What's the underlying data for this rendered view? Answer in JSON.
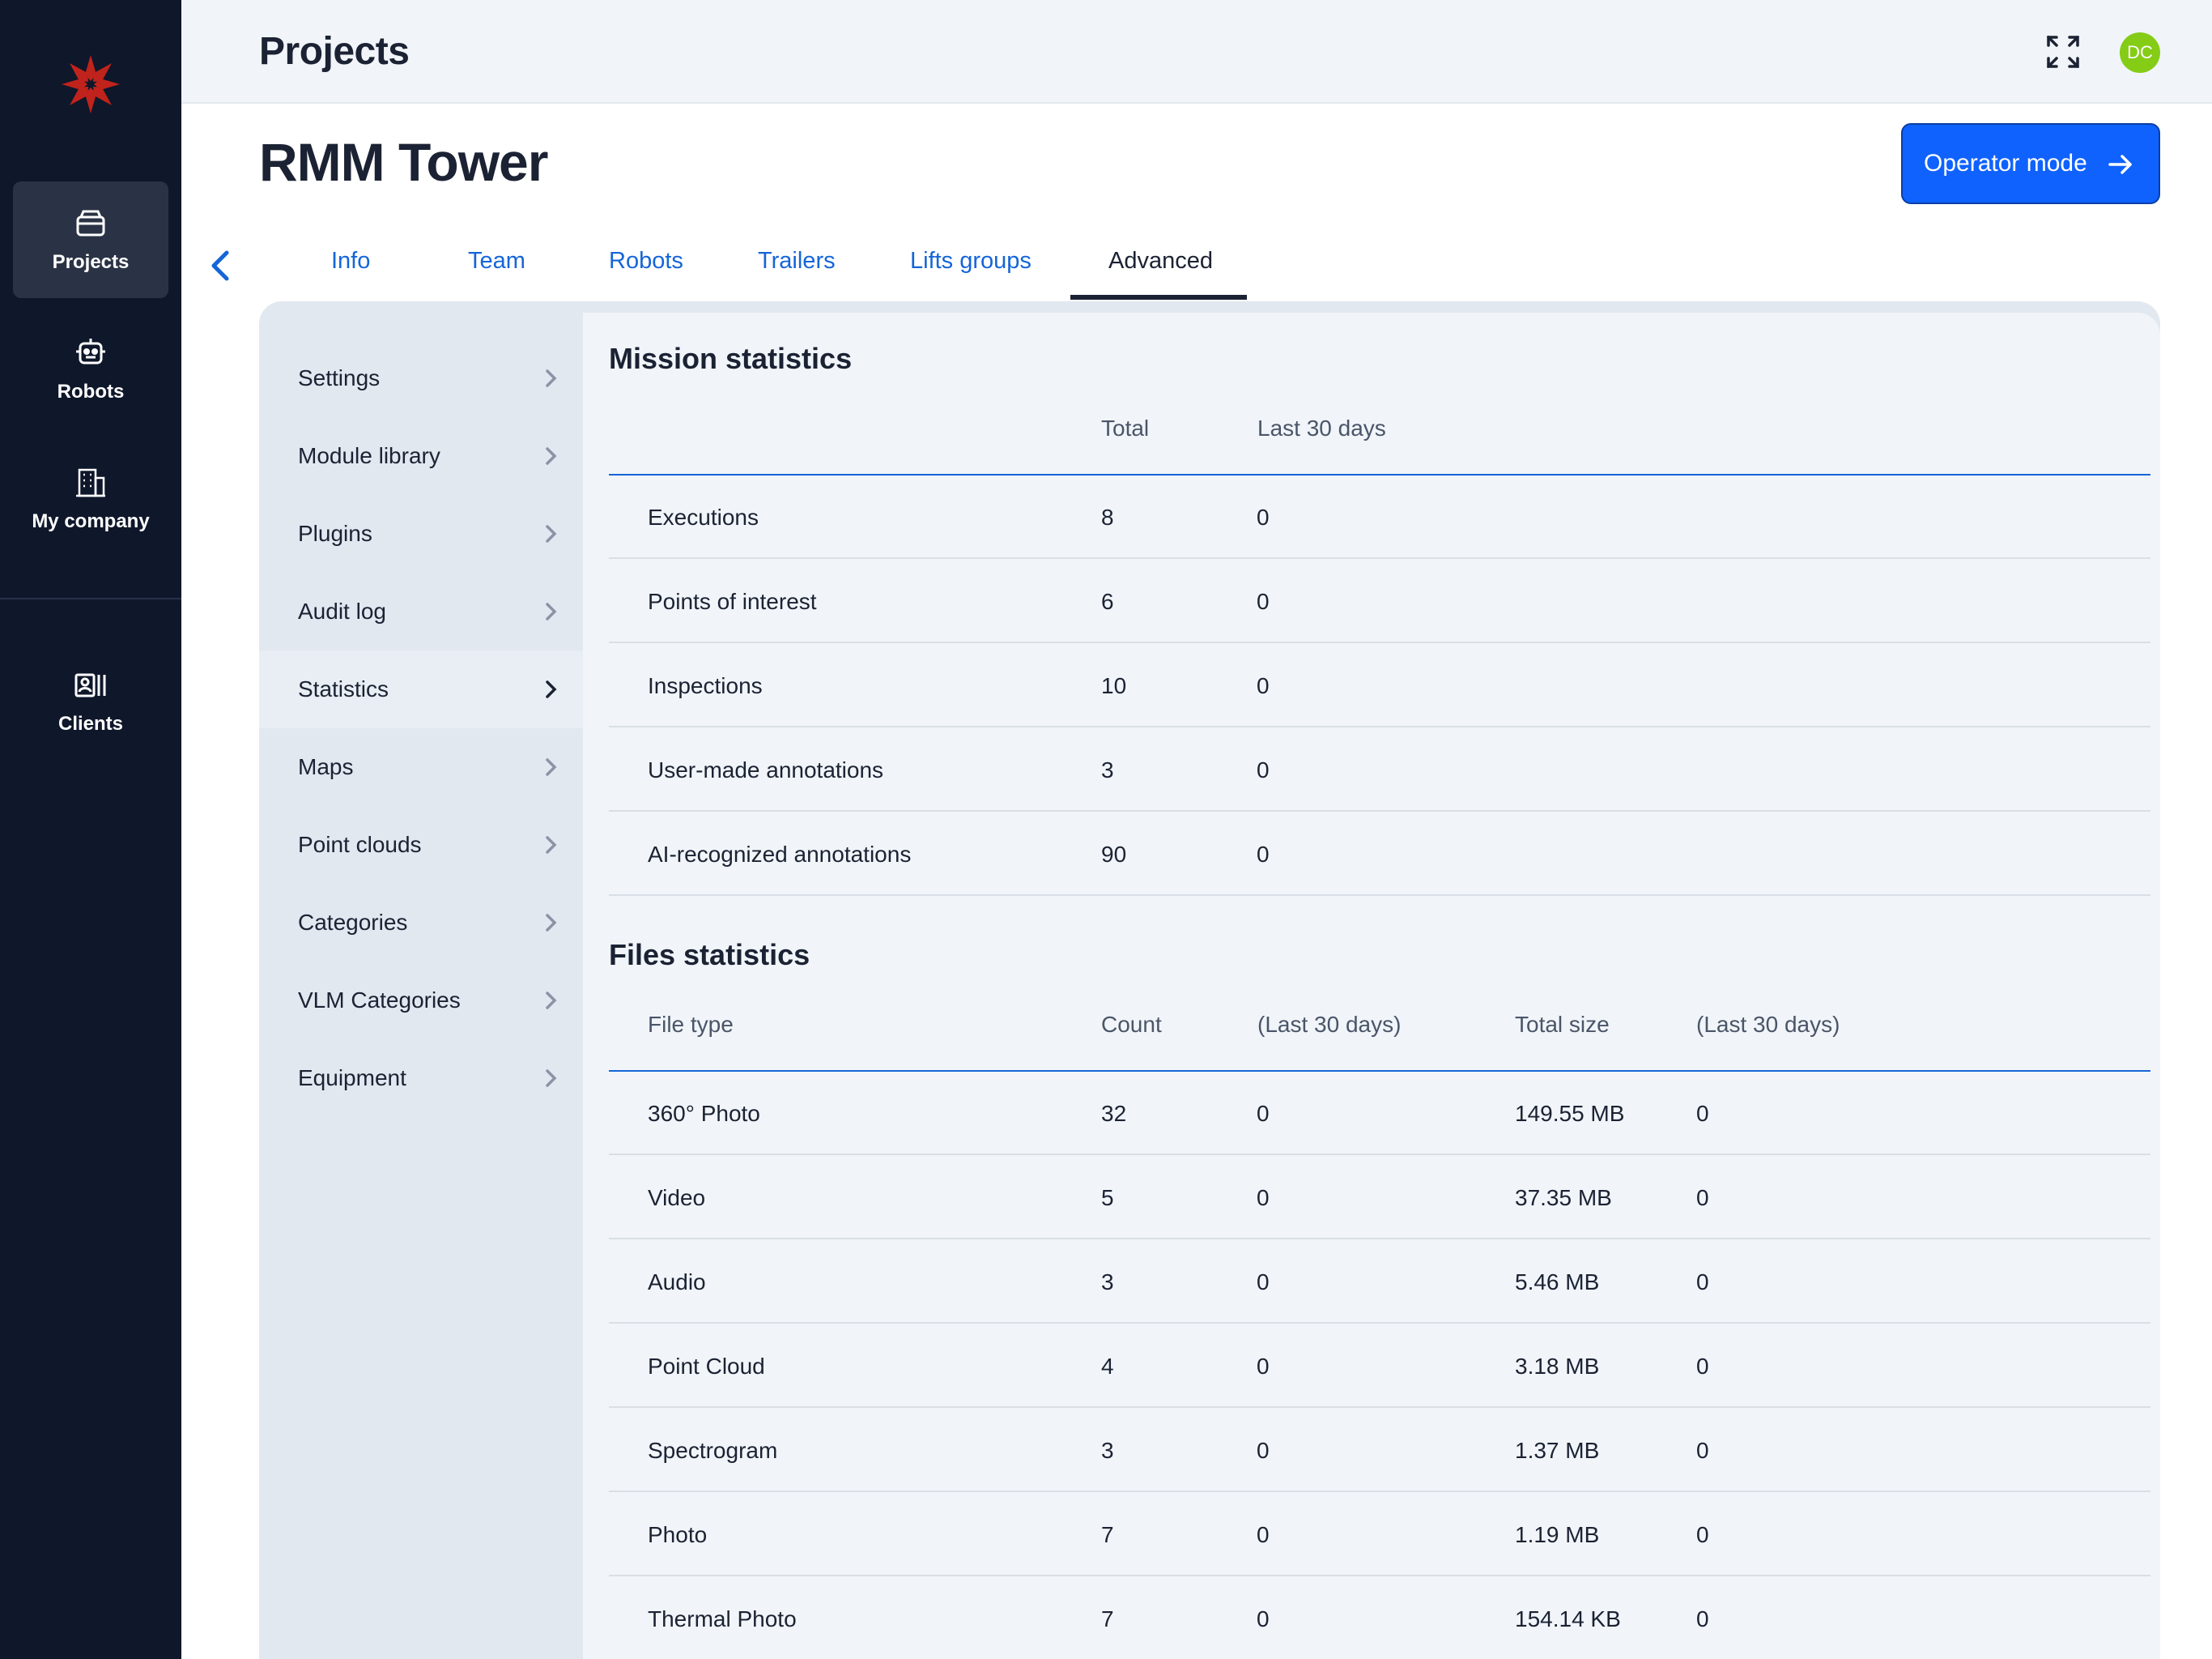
{
  "nav": {
    "items": [
      {
        "label": "Projects",
        "icon": "projects-icon",
        "active": true
      },
      {
        "label": "Robots",
        "icon": "robot-icon",
        "active": false
      },
      {
        "label": "My company",
        "icon": "building-icon",
        "active": false
      },
      {
        "label": "Clients",
        "icon": "clients-icon",
        "active": false
      }
    ]
  },
  "header": {
    "title": "Projects",
    "user_initials": "DC",
    "avatar_color": "#84cc16"
  },
  "project": {
    "name": "RMM Tower",
    "operator_button": "Operator mode"
  },
  "tabs": [
    {
      "label": "Info",
      "active": false
    },
    {
      "label": "Team",
      "active": false
    },
    {
      "label": "Robots",
      "active": false
    },
    {
      "label": "Trailers",
      "active": false
    },
    {
      "label": "Lifts groups",
      "active": false
    },
    {
      "label": "Advanced",
      "active": true
    }
  ],
  "side_menu": [
    {
      "label": "Settings",
      "active": false
    },
    {
      "label": "Module library",
      "active": false
    },
    {
      "label": "Plugins",
      "active": false
    },
    {
      "label": "Audit log",
      "active": false
    },
    {
      "label": "Statistics",
      "active": true
    },
    {
      "label": "Maps",
      "active": false
    },
    {
      "label": "Point clouds",
      "active": false
    },
    {
      "label": "Categories",
      "active": false
    },
    {
      "label": "VLM Categories",
      "active": false
    },
    {
      "label": "Equipment",
      "active": false
    }
  ],
  "mission_stats": {
    "title": "Mission statistics",
    "columns": [
      "",
      "Total",
      "Last 30 days"
    ],
    "rows": [
      {
        "name": "Executions",
        "total": "8",
        "last30": "0"
      },
      {
        "name": "Points of interest",
        "total": "6",
        "last30": "0"
      },
      {
        "name": "Inspections",
        "total": "10",
        "last30": "0"
      },
      {
        "name": "User-made annotations",
        "total": "3",
        "last30": "0"
      },
      {
        "name": "AI-recognized annotations",
        "total": "90",
        "last30": "0"
      }
    ]
  },
  "files_stats": {
    "title": "Files statistics",
    "columns": [
      "File type",
      "Count",
      "(Last 30 days)",
      "Total size",
      "(Last 30 days)"
    ],
    "rows": [
      {
        "type": "360° Photo",
        "count": "32",
        "count30": "0",
        "size": "149.55 MB",
        "size30": "0"
      },
      {
        "type": "Video",
        "count": "5",
        "count30": "0",
        "size": "37.35 MB",
        "size30": "0"
      },
      {
        "type": "Audio",
        "count": "3",
        "count30": "0",
        "size": "5.46 MB",
        "size30": "0"
      },
      {
        "type": "Point Cloud",
        "count": "4",
        "count30": "0",
        "size": "3.18 MB",
        "size30": "0"
      },
      {
        "type": "Spectrogram",
        "count": "3",
        "count30": "0",
        "size": "1.37 MB",
        "size30": "0"
      },
      {
        "type": "Photo",
        "count": "7",
        "count30": "0",
        "size": "1.19 MB",
        "size30": "0"
      },
      {
        "type": "Thermal Photo",
        "count": "7",
        "count30": "0",
        "size": "154.14 KB",
        "size30": "0"
      }
    ]
  },
  "colors": {
    "rail": "#0f172a",
    "primary": "#0f62fe",
    "link": "#1565d8",
    "logo": "#c0231b"
  }
}
